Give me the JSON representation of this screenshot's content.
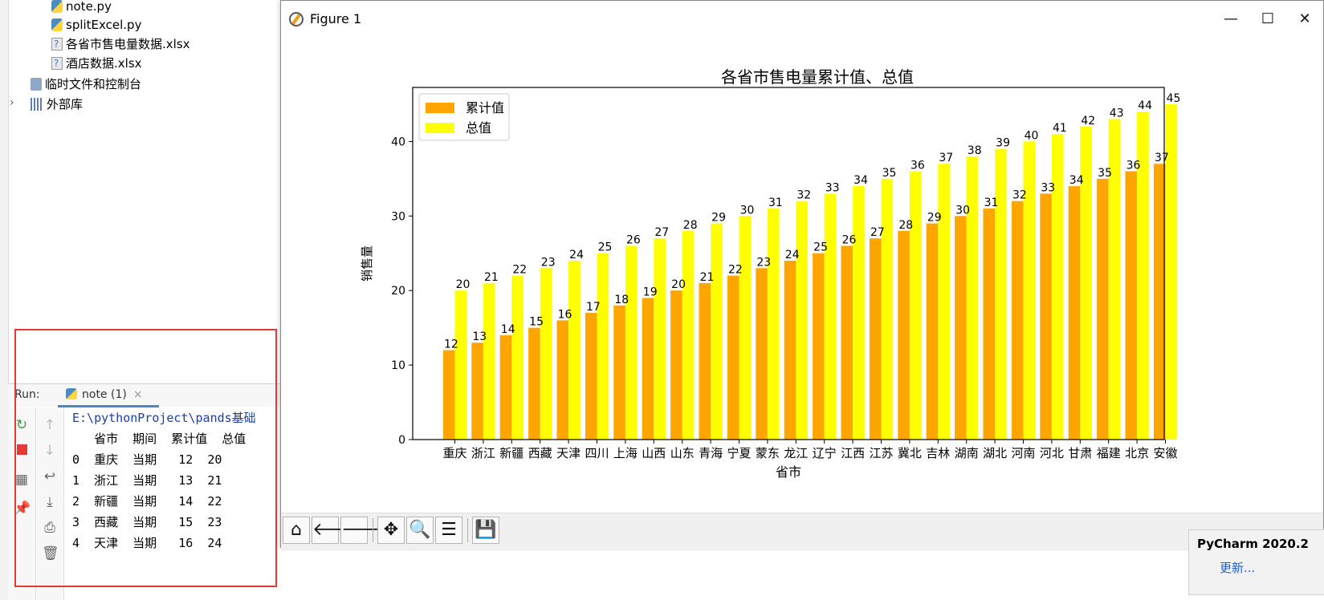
{
  "project_tree": {
    "items": [
      {
        "label": "note.py",
        "icon": "python-file-icon"
      },
      {
        "label": "splitExcel.py",
        "icon": "python-file-icon"
      },
      {
        "label": "各省市售电量数据.xlsx",
        "icon": "unknown-file-icon"
      },
      {
        "label": "酒店数据.xlsx",
        "icon": "unknown-file-icon"
      },
      {
        "label": "临时文件和控制台",
        "icon": "console-icon"
      },
      {
        "label": "外部库",
        "icon": "library-icon"
      }
    ]
  },
  "run_panel": {
    "label": "Run:",
    "tab": "note (1)",
    "console_lines": [
      "E:\\pythonProject\\pands基础",
      "   省市  期间  累计值  总值",
      "0  重庆  当期   12  20",
      "1  浙江  当期   13  21",
      "2  新疆  当期   14  22",
      "3  西藏  当期   15  23",
      "4  天津  当期   16  24"
    ]
  },
  "figure_window": {
    "title": "Figure 1",
    "controls": {
      "minimize": "—",
      "maximize": "☐",
      "close": "✕"
    }
  },
  "chart_data": {
    "type": "bar",
    "title": "各省市售电量累计值、总值",
    "xlabel": "省市",
    "ylabel": "销售量",
    "categories": [
      "重庆",
      "浙江",
      "新疆",
      "西藏",
      "天津",
      "四川",
      "上海",
      "山西",
      "山东",
      "青海",
      "宁夏",
      "蒙东",
      "龙江",
      "辽宁",
      "江西",
      "江苏",
      "冀北",
      "吉林",
      "湖南",
      "湖北",
      "河南",
      "河北",
      "甘肃",
      "福建",
      "北京",
      "安徽"
    ],
    "series": [
      {
        "name": "累计值",
        "color": "#ffa500",
        "values": [
          12,
          13,
          14,
          15,
          16,
          17,
          18,
          19,
          20,
          21,
          22,
          23,
          24,
          25,
          26,
          27,
          28,
          29,
          30,
          31,
          32,
          33,
          34,
          35,
          36,
          37
        ]
      },
      {
        "name": "总值",
        "color": "#ffff00",
        "values": [
          20,
          21,
          22,
          23,
          24,
          25,
          26,
          27,
          28,
          29,
          30,
          31,
          32,
          33,
          34,
          35,
          36,
          37,
          38,
          39,
          40,
          41,
          42,
          43,
          44,
          45
        ]
      }
    ],
    "yticks": [
      0,
      10,
      20,
      30,
      40
    ],
    "ylim": [
      0,
      47.25
    ],
    "legend_position": "upper left",
    "grid": false
  },
  "mpl_toolbar": {
    "buttons": [
      {
        "name": "home-icon",
        "glyph": "⌂"
      },
      {
        "name": "back-arrow-icon",
        "glyph": "🡐"
      },
      {
        "name": "forward-arrow-icon",
        "glyph": "🡒"
      },
      {
        "name": "pan-icon",
        "glyph": "✥"
      },
      {
        "name": "zoom-icon",
        "glyph": "🔍"
      },
      {
        "name": "configure-subplots-icon",
        "glyph": "☰"
      },
      {
        "name": "save-icon",
        "glyph": "💾"
      }
    ]
  },
  "notification": {
    "title": "PyCharm 2020.2",
    "link": "更新..."
  }
}
